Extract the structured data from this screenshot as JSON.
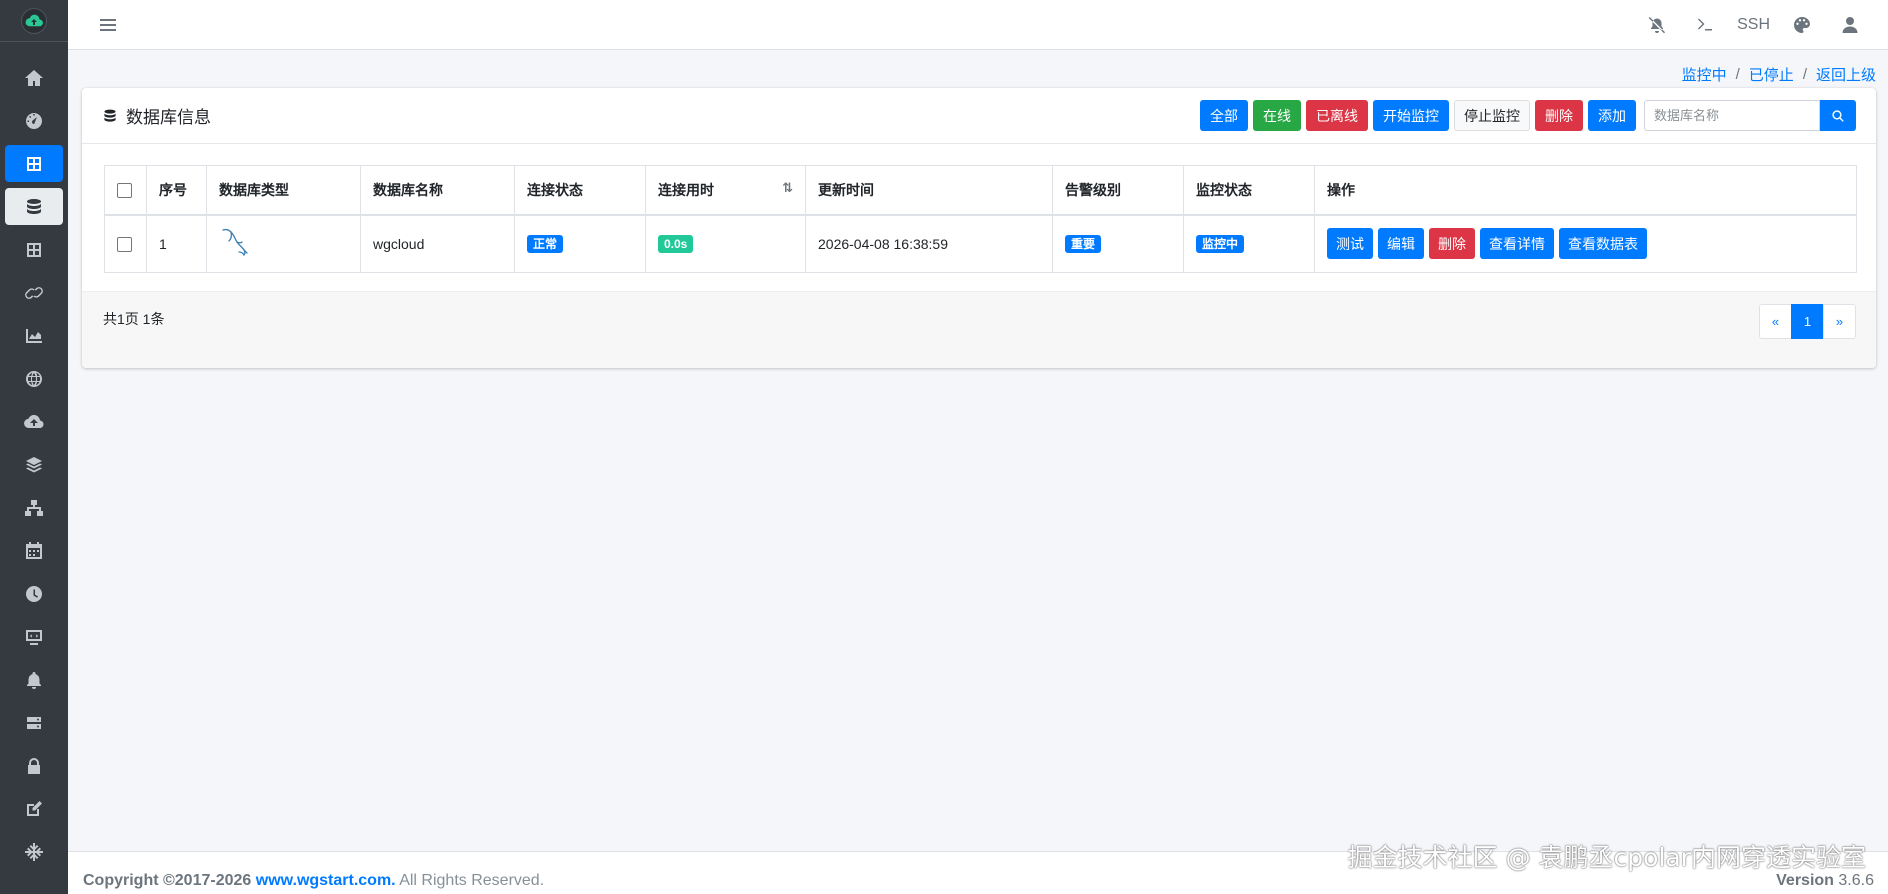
{
  "topbar": {
    "ssh_label": "SSH"
  },
  "breadcrumb": {
    "items": [
      "监控中",
      "已停止",
      "返回上级"
    ],
    "separator": "/"
  },
  "card": {
    "title": "数据库信息",
    "buttons": {
      "all": "全部",
      "online": "在线",
      "offline": "已离线",
      "start_monitor": "开始监控",
      "stop_monitor": "停止监控",
      "delete": "删除",
      "add": "添加"
    },
    "search_placeholder": "数据库名称"
  },
  "table": {
    "headers": [
      "序号",
      "数据库类型",
      "数据库名称",
      "连接状态",
      "连接用时",
      "更新时间",
      "告警级别",
      "监控状态",
      "操作"
    ],
    "sort_icon": "⇅",
    "rows": [
      {
        "index": "1",
        "db_type_icon": "mysql-dolphin-icon",
        "name": "wgcloud",
        "status": "正常",
        "latency": "0.0s",
        "updated": "2026-04-08 16:38:59",
        "alarm": "重要",
        "monitor": "监控中",
        "actions": [
          "测试",
          "编辑",
          "删除",
          "查看详情",
          "查看数据表"
        ]
      }
    ]
  },
  "pagination": {
    "summary": "共1页 1条",
    "prev": "«",
    "current": "1",
    "next": "»"
  },
  "footer": {
    "copyright_prefix": "Copyright ©2017-2026",
    "site": "www.wgstart.com.",
    "rights": "All Rights Reserved.",
    "version_label": "Version",
    "version": "3.6.6"
  },
  "watermark": "掘金技术社区 @ 袁鹏丞cpolar内网穿透实验室",
  "colors": {
    "sidebar": "#343a40",
    "primary": "#007bff",
    "success": "#28a745",
    "danger": "#dc3545",
    "teal": "#20c997"
  }
}
